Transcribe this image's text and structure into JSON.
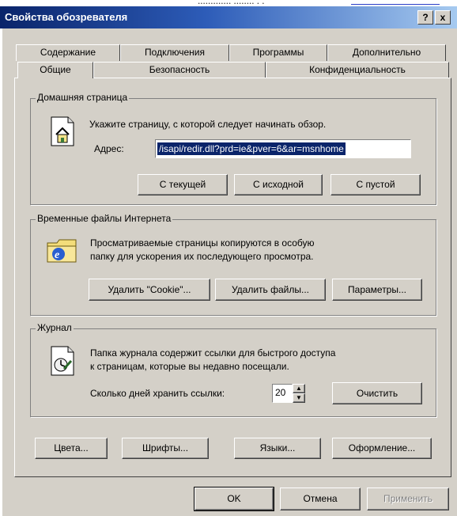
{
  "window": {
    "title": "Свойства обозревателя",
    "help_button": "?",
    "close_button": "x"
  },
  "tabs": {
    "row1": [
      "Содержание",
      "Подключения",
      "Программы",
      "Дополнительно"
    ],
    "row2": [
      "Общие",
      "Безопасность",
      "Конфиденциальность"
    ]
  },
  "home_page": {
    "title": "Домашняя страница",
    "description": "Укажите страницу, с которой следует начинать обзор.",
    "address_label": "Адрес:",
    "address_value": "/isapi/redir.dll?prd=ie&pver=6&ar=msnhome",
    "buttons": [
      "С текущей",
      "С исходной",
      "С пустой"
    ]
  },
  "temp_files": {
    "title": "Временные файлы Интернета",
    "line1": "Просматриваемые страницы копируются в особую",
    "line2": "папку для ускорения их последующего просмотра.",
    "buttons": [
      "Удалить \"Cookie\"...",
      "Удалить файлы...",
      "Параметры..."
    ]
  },
  "history": {
    "title": "Журнал",
    "line1": "Папка журнала содержит ссылки для быстрого доступа",
    "line2": "к страницам, которые вы недавно посещали.",
    "days_label": "Сколько дней хранить ссылки:",
    "days_value": "20",
    "clear_button": "Очистить"
  },
  "bottom_buttons": [
    "Цвета...",
    "Шрифты...",
    "Языки...",
    "Оформление..."
  ],
  "dialog_buttons": {
    "ok": "OK",
    "cancel": "Отмена",
    "apply": "Применить"
  },
  "colors": {
    "title_start": "#0a246a",
    "title_end": "#a6caf0",
    "face": "#d4d0c8",
    "selection": "#0a246a"
  }
}
